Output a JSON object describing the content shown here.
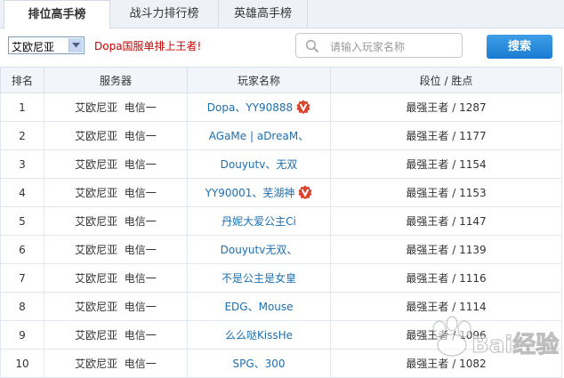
{
  "tabs": [
    {
      "label": "排位高手榜",
      "active": true
    },
    {
      "label": "战斗力排行榜",
      "active": false
    },
    {
      "label": "英雄高手榜",
      "active": false
    }
  ],
  "toolbar": {
    "server_selected": "艾欧尼亚",
    "promo_text": "Dopa国服单排上王者!",
    "search_placeholder": "请输入玩家名称",
    "search_button": "搜索"
  },
  "table": {
    "headers": [
      "排名",
      "服务器",
      "玩家名称",
      "段位 / 胜点"
    ],
    "rows": [
      {
        "rank": "1",
        "server": "艾欧尼亚  电信一",
        "player": "Dopa、YY90888",
        "badge": true,
        "dan": "最强王者 / 1287"
      },
      {
        "rank": "2",
        "server": "艾欧尼亚  电信一",
        "player": "AGaMe | aDreaM、",
        "badge": false,
        "dan": "最强王者 / 1177"
      },
      {
        "rank": "3",
        "server": "艾欧尼亚  电信一",
        "player": "Douyutv、无双",
        "badge": false,
        "dan": "最强王者 / 1154"
      },
      {
        "rank": "4",
        "server": "艾欧尼亚  电信一",
        "player": "YY90001、芜湖神",
        "badge": true,
        "dan": "最强王者 / 1153"
      },
      {
        "rank": "5",
        "server": "艾欧尼亚  电信一",
        "player": "丹妮大爱公主Ci",
        "badge": false,
        "dan": "最强王者 / 1147"
      },
      {
        "rank": "6",
        "server": "艾欧尼亚  电信一",
        "player": "Douyutv无双、",
        "badge": false,
        "dan": "最强王者 / 1139"
      },
      {
        "rank": "7",
        "server": "艾欧尼亚  电信一",
        "player": "不是公主是女皇",
        "badge": false,
        "dan": "最强王者 / 1116"
      },
      {
        "rank": "8",
        "server": "艾欧尼亚  电信一",
        "player": "EDG、Mouse",
        "badge": false,
        "dan": "最强王者 / 1114"
      },
      {
        "rank": "9",
        "server": "艾欧尼亚  电信一",
        "player": "么么哒KissHe",
        "badge": false,
        "dan": "最强王者 / 1096"
      },
      {
        "rank": "10",
        "server": "艾欧尼亚  电信一",
        "player": "SPG、300",
        "badge": false,
        "dan": "最强王者 / 1082"
      }
    ]
  },
  "colors": {
    "player_link": "#1c6fb0",
    "promo": "#cc0000",
    "search_button": "#1a7cd1",
    "badge": "#d9452f"
  },
  "watermark": {
    "text": "Bai经验"
  }
}
